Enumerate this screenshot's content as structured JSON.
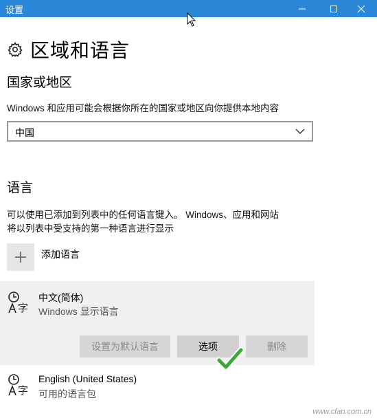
{
  "window": {
    "title": "设置"
  },
  "page": {
    "title": "区域和语言"
  },
  "region": {
    "section_title": "国家或地区",
    "description": "Windows 和应用可能会根据你所在的国家或地区向你提供本地内容",
    "selected_value": "中国"
  },
  "language": {
    "section_title": "语言",
    "description_line1": "可以使用已添加到列表中的任何语言键入。 Windows、应用和网站",
    "description_line2": "将以列表中受支持的第一种语言进行显示",
    "add_label": "添加语言",
    "items": [
      {
        "name": "中文(简体)",
        "status": "Windows 显示语言",
        "selected": true
      },
      {
        "name": "English (United States)",
        "status": "可用的语言包",
        "selected": false
      }
    ],
    "buttons": {
      "set_default": "设置为默认语言",
      "options": "选项",
      "remove": "删除"
    }
  },
  "icons": {
    "gear": "gear-icon",
    "language": "language-icon",
    "add": "plus-icon",
    "check": "checkmark-icon"
  },
  "colors": {
    "titlebar": "#2b88d8",
    "panel": "#f0f0f0",
    "check": "#3aa935"
  },
  "watermark": "www.cfan.com.cn"
}
